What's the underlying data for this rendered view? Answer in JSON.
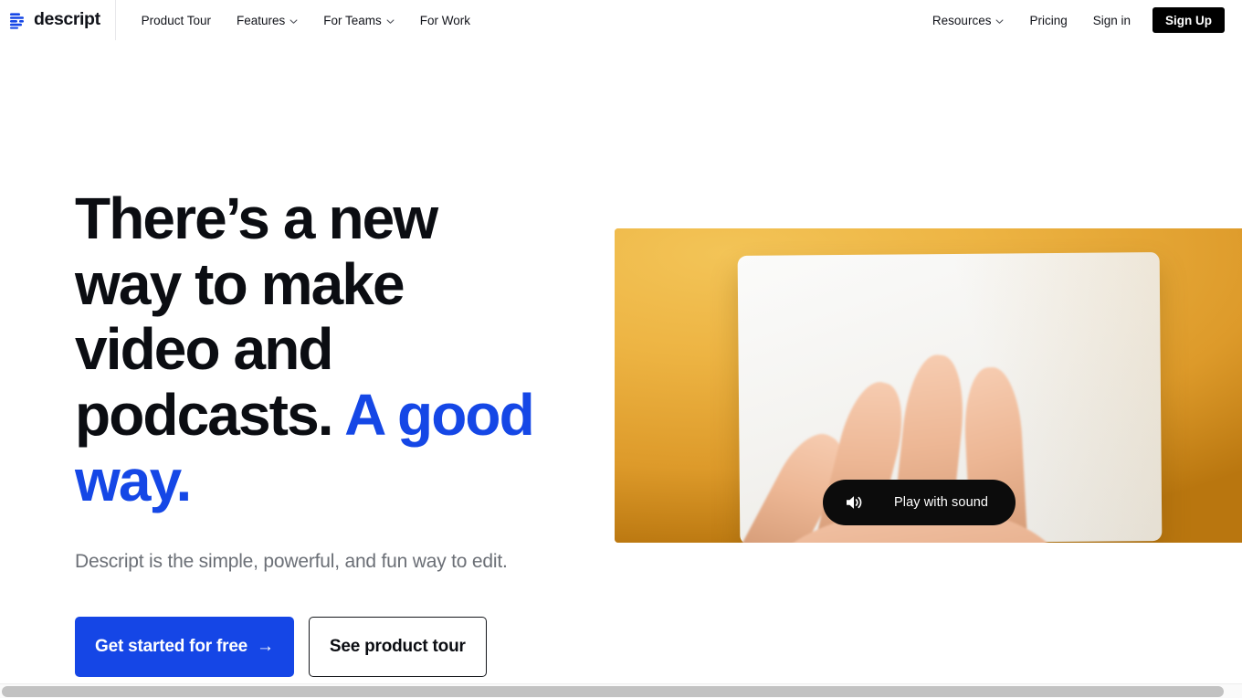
{
  "nav": {
    "brand": {
      "name": "descript",
      "icon": "descript-logo-icon"
    },
    "links": [
      {
        "label": "Product Tour",
        "has_dropdown": false
      },
      {
        "label": "Features",
        "has_dropdown": true
      },
      {
        "label": "For Teams",
        "has_dropdown": true
      },
      {
        "label": "For Work",
        "has_dropdown": false
      }
    ],
    "right_links": [
      {
        "label": "Resources",
        "has_dropdown": true
      },
      {
        "label": "Pricing",
        "has_dropdown": false
      },
      {
        "label": "Sign in",
        "has_dropdown": false
      }
    ],
    "signup_label": "Sign Up"
  },
  "hero": {
    "headline_part1": "There’s a new way to make video and podcasts. ",
    "headline_accent": "A good way.",
    "subhead": "Descript is the simple, powerful, and fun way to edit.",
    "cta_primary": "Get started for free",
    "cta_primary_arrow": "→",
    "cta_secondary": "See product tour"
  },
  "video": {
    "play_label": "Play with sound",
    "play_icon": "speaker-sound-icon"
  },
  "colors": {
    "accent_blue": "#1546e6",
    "text_dark": "#0b0d12",
    "text_muted": "#6b6f76",
    "signup_black": "#000000",
    "video_background": "#e9a937"
  }
}
